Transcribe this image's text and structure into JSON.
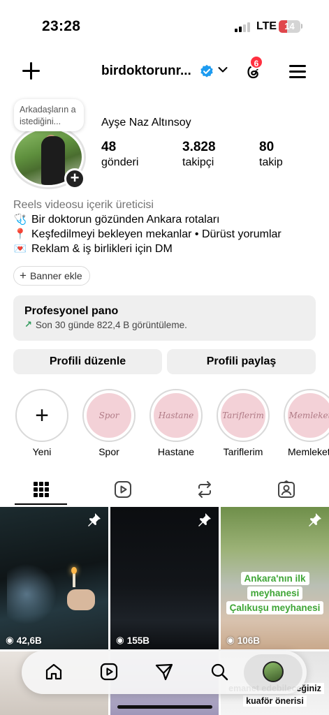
{
  "status_bar": {
    "time": "23:28",
    "network": "LTE",
    "battery": "14"
  },
  "header": {
    "username": "birdoktorunr...",
    "notification_count": "6"
  },
  "profile": {
    "note": "Arkadaşların a istediğini...",
    "full_name": "Ayşe Naz Altınsoy",
    "stats": [
      {
        "value": "48",
        "label": "gönderi"
      },
      {
        "value": "3.828",
        "label": "takipçi"
      },
      {
        "value": "80",
        "label": "takip"
      }
    ],
    "category": "Reels videosu içerik üreticisi",
    "bio_lines": [
      {
        "emoji": "🩺",
        "text": "Bir doktorun gözünden Ankara rotaları"
      },
      {
        "emoji": "📍",
        "text": "Keşfedilmeyi bekleyen mekanlar • Dürüst yorumlar"
      },
      {
        "emoji": "💌",
        "text": "Reklam & iş birlikleri için DM"
      }
    ],
    "banner_button": "Banner ekle"
  },
  "dashboard": {
    "title": "Profesyonel pano",
    "subtitle": "Son 30 günde 822,4 B görüntüleme."
  },
  "buttons": {
    "edit": "Profili düzenle",
    "share": "Profili paylaş"
  },
  "highlights": [
    {
      "label": "Yeni",
      "cover": ""
    },
    {
      "label": "Spor",
      "cover": "Spor"
    },
    {
      "label": "Hastane",
      "cover": "Hastane"
    },
    {
      "label": "Tariflerim",
      "cover": "Tariflerim"
    },
    {
      "label": "Memleket",
      "cover": "Memleket"
    }
  ],
  "tabs": [
    "grid-icon",
    "reels-icon",
    "reposts-icon",
    "tagged-icon"
  ],
  "posts": [
    {
      "views": "42,6B",
      "pinned": true,
      "caption": []
    },
    {
      "views": "155B",
      "pinned": true,
      "caption": []
    },
    {
      "views": "106B",
      "pinned": true,
      "caption": [
        "Ankara'nın ilk",
        "meyhanesi",
        "Çalıkuşu meyhanesi"
      ]
    }
  ],
  "bottom_posts_caption": [
    "emanet edebileceğiniz",
    "kuaför önerisi"
  ],
  "colors": {
    "badge": "#ff3040",
    "verified": "#1d9bf0",
    "pill": "#efefef",
    "caption_green": "#3ea535"
  }
}
